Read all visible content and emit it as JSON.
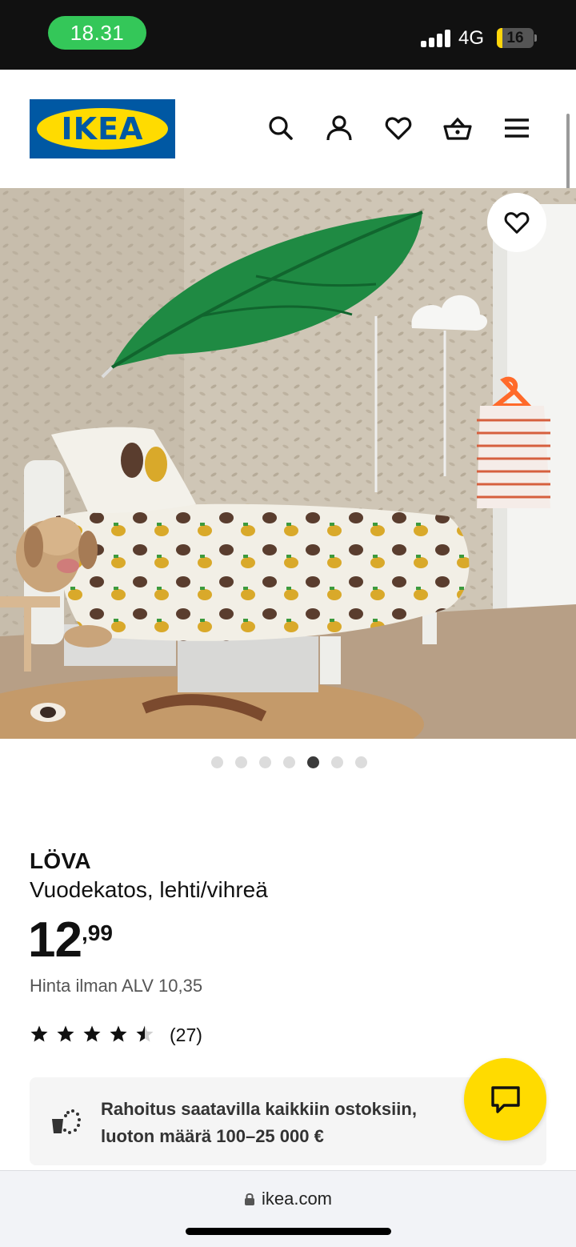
{
  "status_bar": {
    "time": "18.31",
    "network": "4G",
    "battery": "16"
  },
  "header": {
    "logo_text": "IKEA",
    "logo_mark": "®",
    "icons": [
      "search-icon",
      "account-icon",
      "favorites-icon",
      "cart-icon",
      "menu-icon"
    ]
  },
  "gallery": {
    "image_count": 7,
    "active_index": 4
  },
  "product": {
    "name": "LÖVA",
    "description": "Vuodekatos, lehti/vihreä",
    "price_integer": "12",
    "price_decimal": ",99",
    "vat_note": "Hinta ilman ALV 10,35",
    "rating": 4.5,
    "rating_max": 5,
    "review_count": "(27)"
  },
  "financing": {
    "text_line1": "Rahoitus saatavilla kaikkiin ostoksiin,",
    "text_line2": "luoton määrä 100–25 000 €"
  },
  "browser": {
    "url": "ikea.com"
  },
  "colors": {
    "ikea_blue": "#0058a3",
    "ikea_yellow": "#ffdb00",
    "status_green": "#34c759"
  }
}
